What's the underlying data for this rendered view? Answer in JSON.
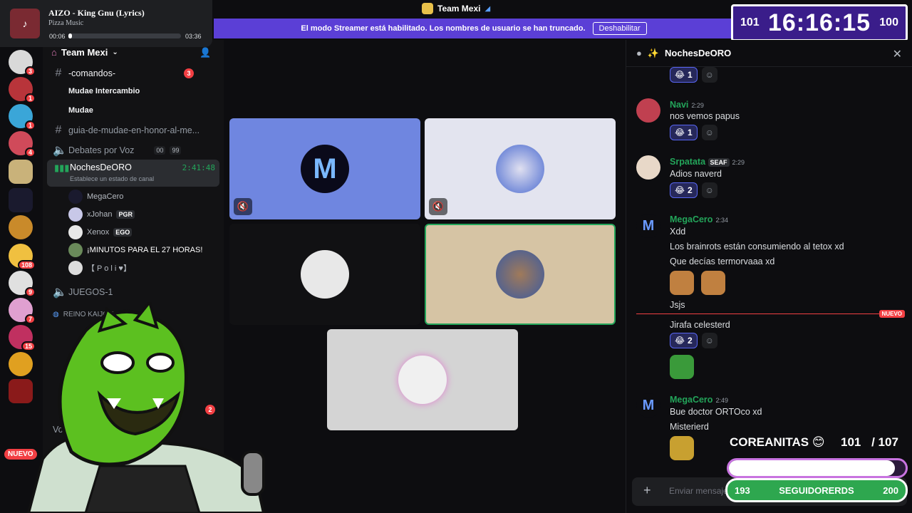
{
  "music": {
    "title": "AIZO - King Gnu (Lyrics)",
    "artist": "Pizza Music",
    "elapsed": "00:06",
    "duration": "03:36",
    "progress": 0.03
  },
  "titlebar": {
    "server": "Team Mexi"
  },
  "banner": {
    "text": "El modo Streamer está habilitado. Los nombres de usuario se han truncado.",
    "button": "Deshabilitar"
  },
  "clock": {
    "left": "101",
    "time": "16:16:15",
    "right": "100"
  },
  "servers": {
    "badges": [
      "3",
      "1",
      "1",
      "4",
      "108",
      "9",
      "7",
      "15"
    ],
    "nuevo": "NUEVO"
  },
  "sidebar": {
    "server_name": "Team Mexi",
    "channels": [
      {
        "label": "-comandos-",
        "badge": "3"
      },
      {
        "label": "Mudae Intercambio"
      },
      {
        "label": "Mudae"
      },
      {
        "label": "guia-de-mudae-en-honor-al-me..."
      },
      {
        "label": "Debates por Voz",
        "count1": "00",
        "count2": "99"
      },
      {
        "label": "JUEGOS-1"
      },
      {
        "label": "REINO KAIJO-S"
      },
      {
        "label": "Voz"
      }
    ],
    "active_voice": {
      "label": "NochesDeORO",
      "timer": "2:41:48",
      "status": "Establece un estado de canal"
    },
    "voice_users": [
      {
        "name": "MegaCero"
      },
      {
        "name": "xJohan",
        "tag": "PGR"
      },
      {
        "name": "Xenox",
        "tag": "EGO"
      },
      {
        "name": "¡MINUTOS PARA EL 27 HORAS!"
      },
      {
        "name": "【 P o l i ♥】"
      }
    ],
    "bottom_badge": "2"
  },
  "chat": {
    "title": "NochesDeORO",
    "messages": [
      {
        "author": "Navi",
        "time": "2:29",
        "lines": [
          "nos vemos papus"
        ],
        "reaction": "1",
        "color": "#23a55a"
      },
      {
        "author": "Srpatata",
        "tag": "SEAF",
        "time": "2:29",
        "lines": [
          "Adios naverd"
        ],
        "reaction": "2",
        "color": "#23a55a"
      },
      {
        "author": "MegaCero",
        "time": "2:34",
        "lines": [
          "Xdd",
          "Los brainrots están consumiendo al tetox xd",
          "Que decías termorvaaa xd",
          "Jsjs"
        ],
        "color": "#23a55a"
      },
      {
        "lines": [
          "Jirafa celesterd"
        ],
        "reaction": "2"
      },
      {
        "author": "MegaCero",
        "time": "2:49",
        "lines": [
          "Bue doctor ORTOco xd",
          "Misterierd"
        ],
        "color": "#23a55a"
      }
    ],
    "top_reaction": "1",
    "new_label": "NUEVO",
    "input_placeholder": "Enviar mensaje"
  },
  "overlay": {
    "label": "COREANITAS",
    "count": "101",
    "goal": "/ 107",
    "goal_progress": 0.94,
    "followers_left": "193",
    "followers_label": "SEGUIDORERDS",
    "followers_right": "200"
  }
}
